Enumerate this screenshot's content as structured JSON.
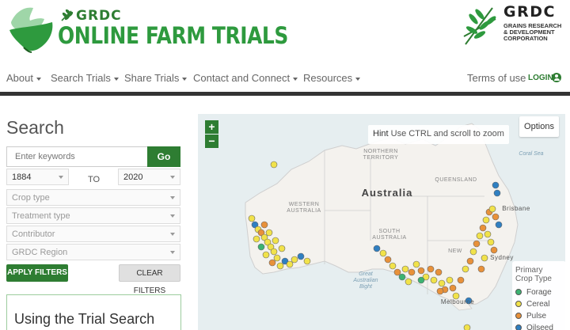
{
  "header": {
    "brand_small": "GRDC",
    "brand_title": "ONLINE FARM TRIALS",
    "partner_name": "GRDC",
    "partner_sub": [
      "GRAINS RESEARCH",
      "& DEVELOPMENT",
      "CORPORATION"
    ]
  },
  "nav": {
    "items": [
      "About",
      "Search Trials",
      "Share Trials",
      "Contact and Connect",
      "Resources"
    ],
    "terms": "Terms of use",
    "login": "LOGIN"
  },
  "search": {
    "title": "Search",
    "keyword_placeholder": "Enter keywords",
    "go_label": "Go",
    "year_from": "1884",
    "to_label": "TO",
    "year_to": "2020",
    "crop_type": "Crop type",
    "treatment_type": "Treatment type",
    "contributor": "Contributor",
    "region": "GRDC Region",
    "apply_label": "APPLY FILTERS",
    "clear_label": "CLEAR FILTERS",
    "info_title": "Using the Trial Search"
  },
  "map": {
    "zoom_in": "+",
    "zoom_out": "−",
    "hint_bold": "Hint",
    "hint_text": "Use CTRL and scroll to zoom",
    "options_label": "Options",
    "labels": {
      "country": "Australia",
      "nt_1": "NORTHERN",
      "nt_2": "TERRITORY",
      "qld": "QUEENSLAND",
      "wa_1": "WESTERN",
      "wa_2": "AUSTRALIA",
      "sa_1": "SOUTH",
      "sa_2": "AUSTRALIA",
      "nsw": "NEW",
      "coral_sea": "Coral Sea",
      "bight_1": "Great",
      "bight_2": "Australian",
      "bight_3": "Bight",
      "brisbane": "Brisbane",
      "sydney": "Sydney",
      "melbourne": "Melbourne"
    },
    "legend": {
      "title_1": "Primary",
      "title_2": "Crop Type",
      "items": [
        {
          "label": "Forage",
          "color": "#3cb371"
        },
        {
          "label": "Cereal",
          "color": "#f1e24a"
        },
        {
          "label": "Pulse",
          "color": "#e8913a"
        },
        {
          "label": "Oilseed",
          "color": "#2f7fc1"
        }
      ]
    }
  }
}
